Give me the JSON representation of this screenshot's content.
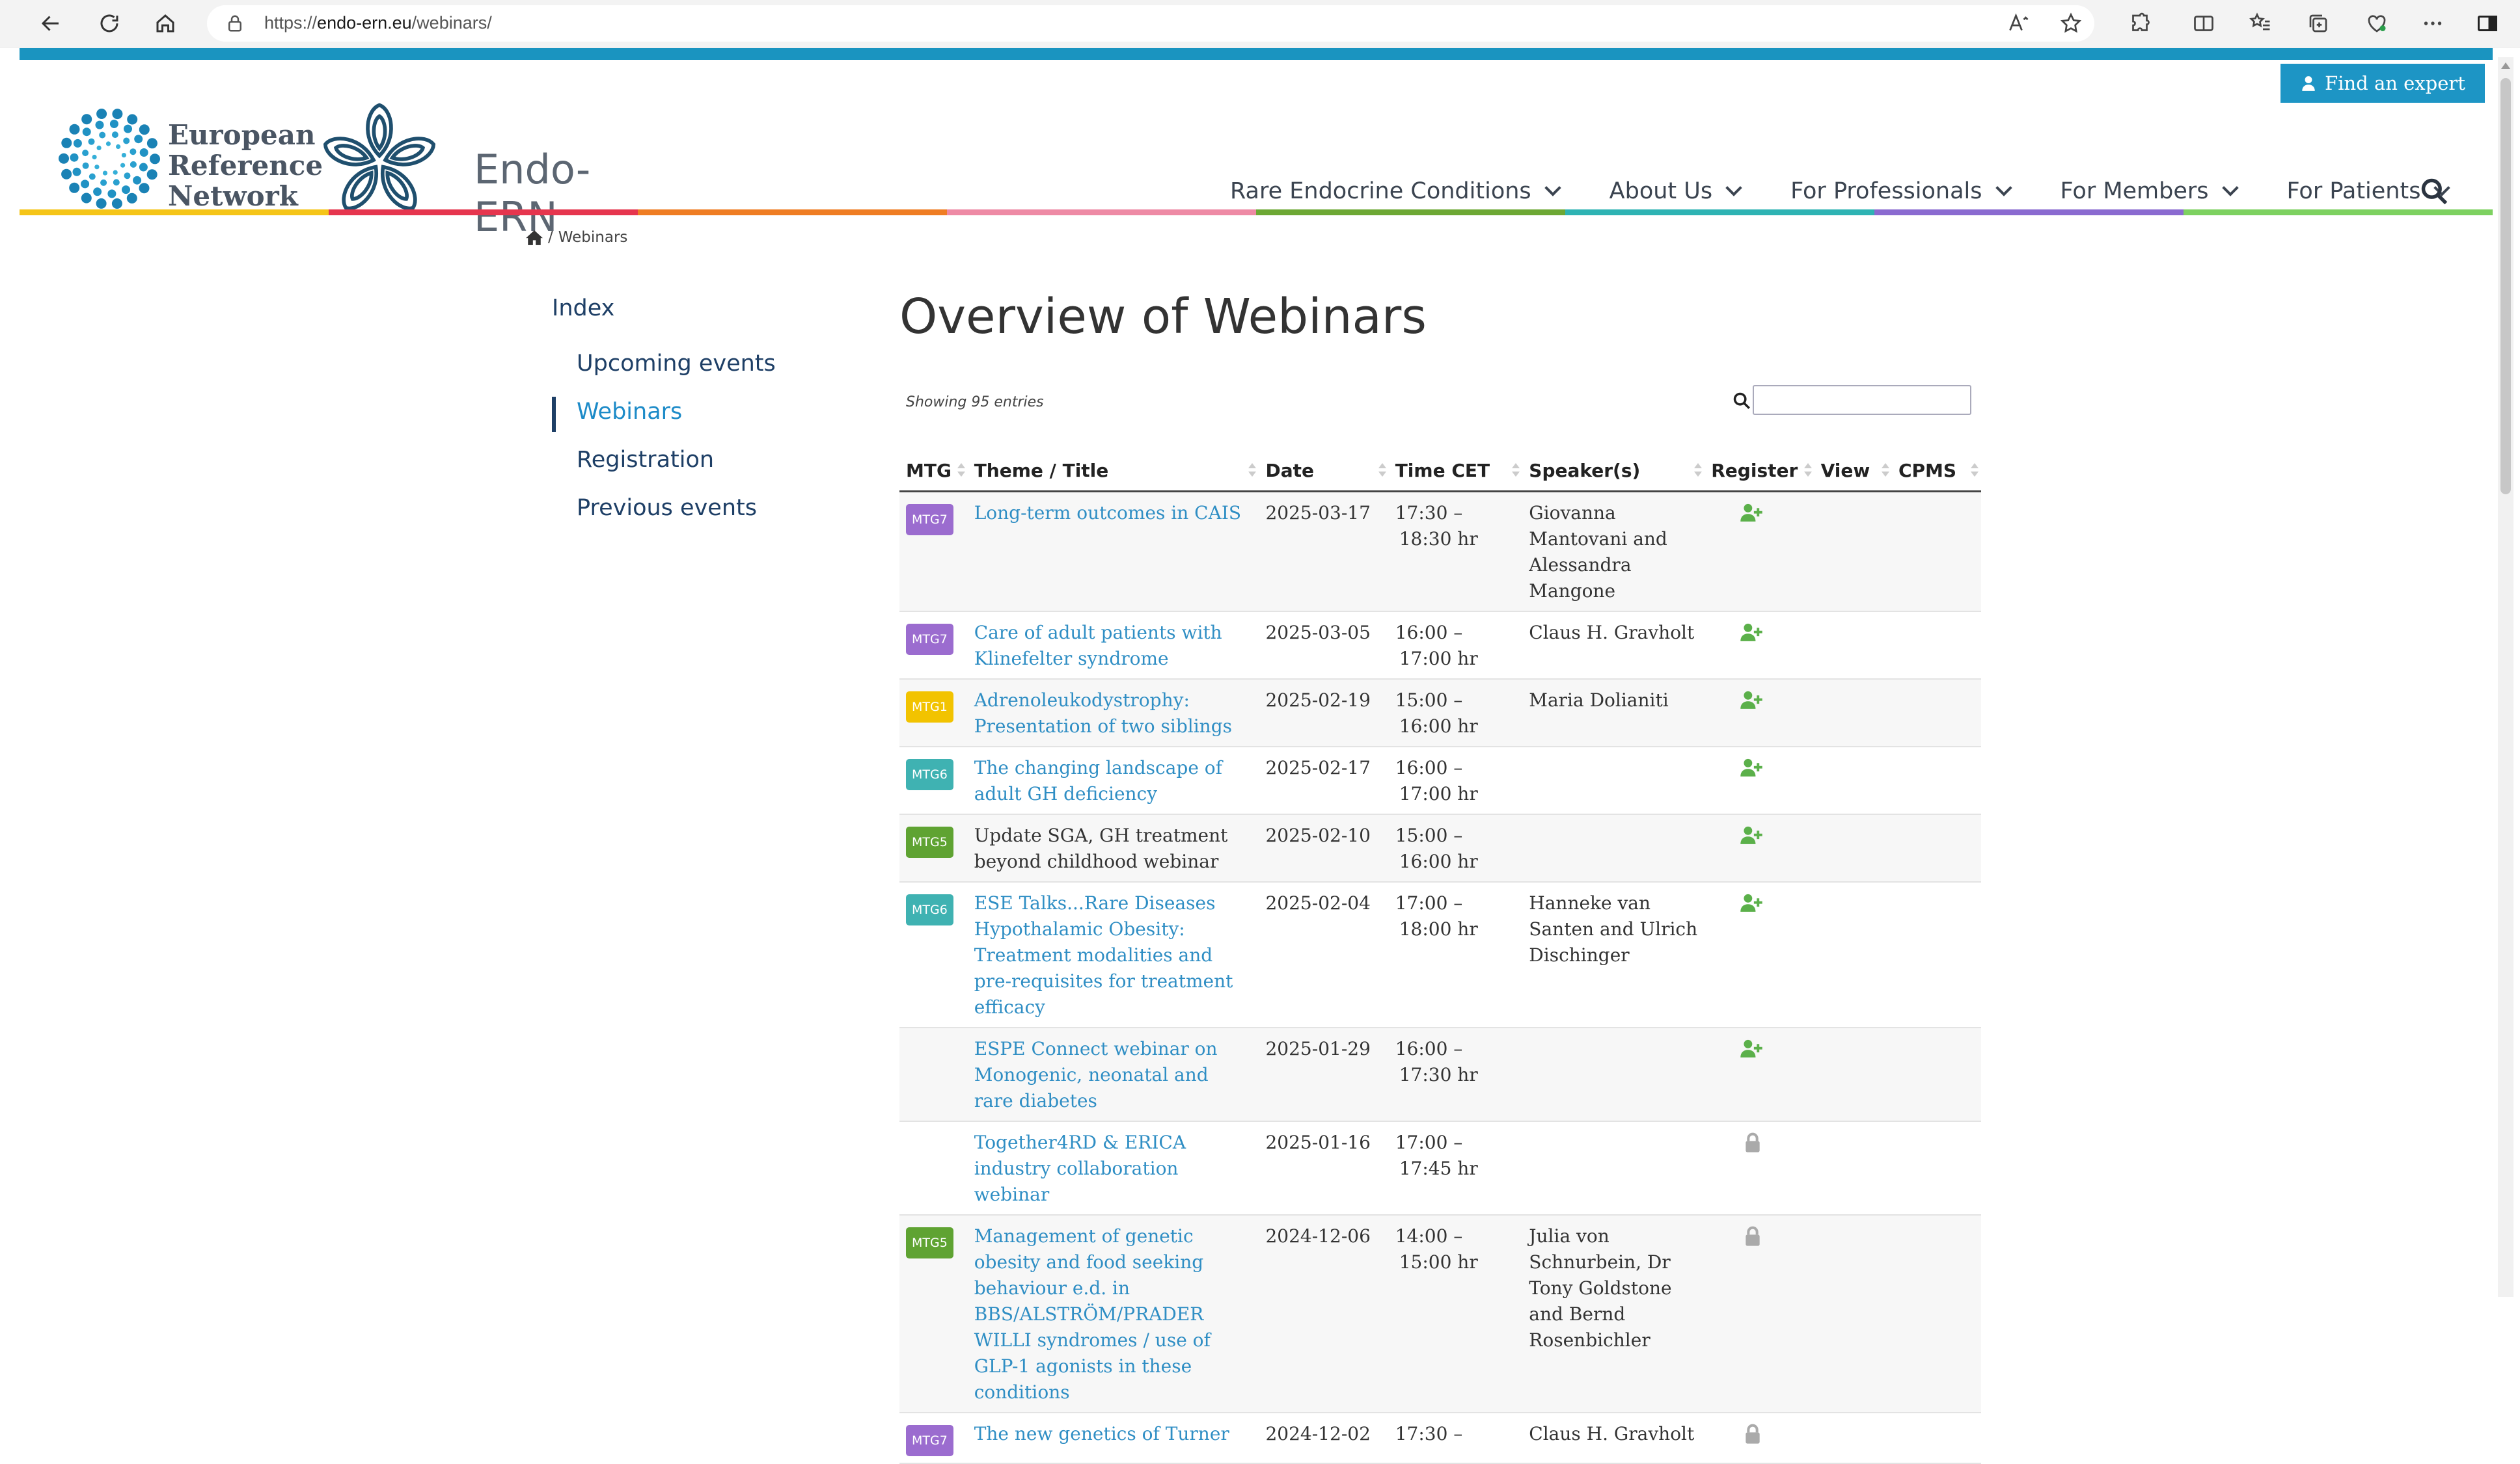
{
  "browser": {
    "url_scheme": "https://",
    "url_host": "endo-ern.eu",
    "url_path": "/webinars/"
  },
  "header": {
    "find_expert": "Find an expert",
    "logo_line1": "European",
    "logo_line2": "Reference",
    "logo_line3": "Network",
    "brand": "Endo-ERN",
    "nav": [
      "Rare Endocrine Conditions",
      "About Us",
      "For Professionals",
      "For Members",
      "For Patients"
    ],
    "rainbow_colors": [
      "#f5c518",
      "#e6354e",
      "#ef7d23",
      "#ee8aa5",
      "#6da834",
      "#2eb3b3",
      "#8a6ad0",
      "#7dd160"
    ]
  },
  "breadcrumb": {
    "sep": "/",
    "current": "Webinars"
  },
  "sidebar": {
    "index_label": "Index",
    "items": [
      "Upcoming events",
      "Webinars",
      "Registration",
      "Previous events"
    ]
  },
  "main": {
    "title": "Overview of Webinars",
    "showing": "Showing 95 entries",
    "columns": [
      "MTG",
      "Theme / Title",
      "Date",
      "Time CET",
      "Speaker(s)",
      "Register",
      "View",
      "CPMS"
    ],
    "rows": [
      {
        "mtg": "MTG7",
        "mtg_color": "#9b6ccf",
        "title": "Long-term outcomes in CAIS",
        "date": "2025-03-17",
        "time1": "17:30 –",
        "time2": "18:30 hr",
        "speakers": "Giovanna Mantovani and Alessandra Mangone",
        "register": "register"
      },
      {
        "mtg": "MTG7",
        "mtg_color": "#9b6ccf",
        "title": "Care of adult patients with Klinefelter syndrome",
        "date": "2025-03-05",
        "time1": "16:00 –",
        "time2": "17:00 hr",
        "speakers": "Claus H. Gravholt",
        "register": "register"
      },
      {
        "mtg": "MTG1",
        "mtg_color": "#f2c300",
        "title": "Adrenoleukodystrophy: Presentation of two siblings",
        "date": "2025-02-19",
        "time1": "15:00 –",
        "time2": "16:00 hr",
        "speakers": "Maria Dolianiti",
        "register": "register"
      },
      {
        "mtg": "MTG6",
        "mtg_color": "#3fb2b2",
        "title": "The changing landscape of adult GH deficiency",
        "date": "2025-02-17",
        "time1": "16:00 –",
        "time2": "17:00 hr",
        "speakers": "",
        "register": "register"
      },
      {
        "mtg": "MTG5",
        "mtg_color": "#5fa332",
        "title": "Update SGA, GH treatment beyond childhood webinar",
        "date": "2025-02-10",
        "time1": "15:00 –",
        "time2": "16:00 hr",
        "speakers": "",
        "register": "register",
        "plain": true
      },
      {
        "mtg": "MTG6",
        "mtg_color": "#3fb2b2",
        "title": "ESE Talks...Rare Diseases Hypothalamic Obesity: Treatment modalities and pre-requisites for treatment efficacy",
        "date": "2025-02-04",
        "time1": "17:00 –",
        "time2": "18:00 hr",
        "speakers": "Hanneke van Santen and Ulrich Dischinger",
        "register": "register"
      },
      {
        "mtg": "",
        "mtg_color": "",
        "title": "ESPE Connect webinar on Monogenic, neonatal and rare diabetes",
        "date": "2025-01-29",
        "time1": "16:00 –",
        "time2": "17:30 hr",
        "speakers": "",
        "register": "register"
      },
      {
        "mtg": "",
        "mtg_color": "",
        "title": "Together4RD & ERICA industry collaboration webinar",
        "date": "2025-01-16",
        "time1": "17:00 –",
        "time2": "17:45 hr",
        "speakers": "",
        "register": "locked"
      },
      {
        "mtg": "MTG5",
        "mtg_color": "#5fa332",
        "title": "Management of genetic obesity and food seeking behaviour e.d. in BBS/ALSTRÖM/PRADER WILLI syndromes / use of GLP-1 agonists in these conditions",
        "date": "2024-12-06",
        "time1": "14:00 –",
        "time2": "15:00 hr",
        "speakers": "Julia von Schnurbein, Dr Tony Goldstone and Bernd Rosenbichler",
        "register": "locked"
      },
      {
        "mtg": "MTG7",
        "mtg_color": "#9b6ccf",
        "title": "The new genetics of Turner",
        "date": "2024-12-02",
        "time1": "17:30 –",
        "time2": "",
        "speakers": "Claus H. Gravholt",
        "register": "locked"
      }
    ]
  }
}
